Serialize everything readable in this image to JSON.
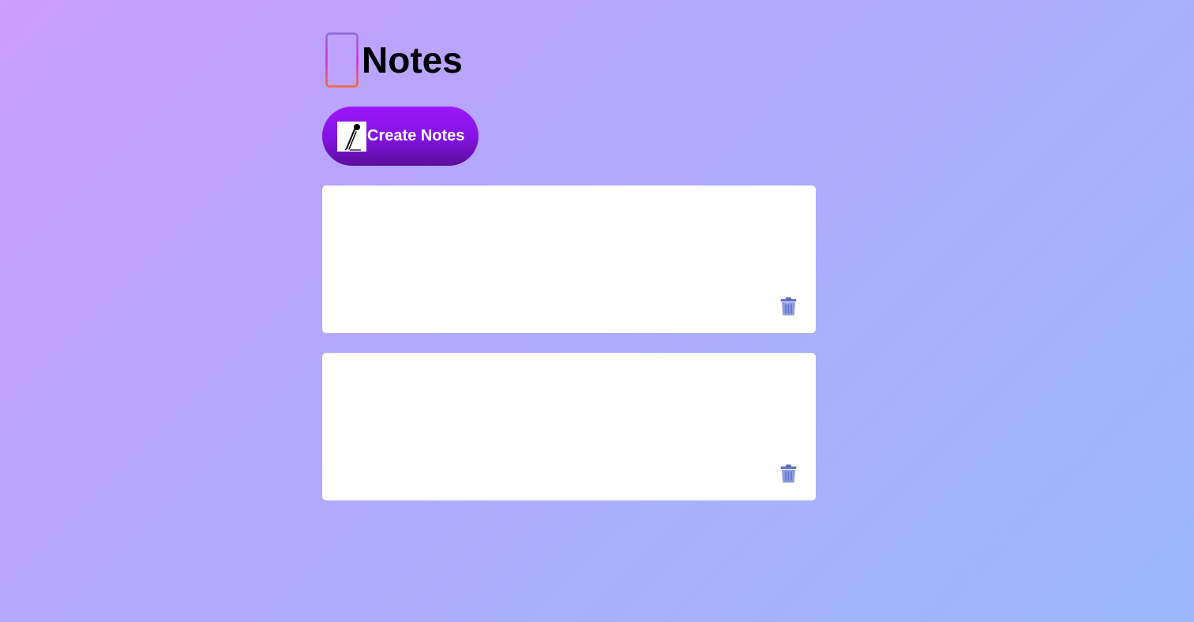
{
  "app": {
    "title": "Notes",
    "logo_icon": "notes-document-icon"
  },
  "toolbar": {
    "create_label": "Create Notes",
    "create_icon": "pencil-icon"
  },
  "notes": [
    {
      "text": "",
      "delete_icon": "trash-icon"
    },
    {
      "text": "",
      "delete_icon": "trash-icon"
    }
  ],
  "colors": {
    "button_gradient_top": "#9b17fb",
    "button_gradient_bottom": "#5b0e9c",
    "background_start": "#cc9efe",
    "background_end": "#9bb8fb",
    "trash_icon": "#7a8dd6"
  }
}
